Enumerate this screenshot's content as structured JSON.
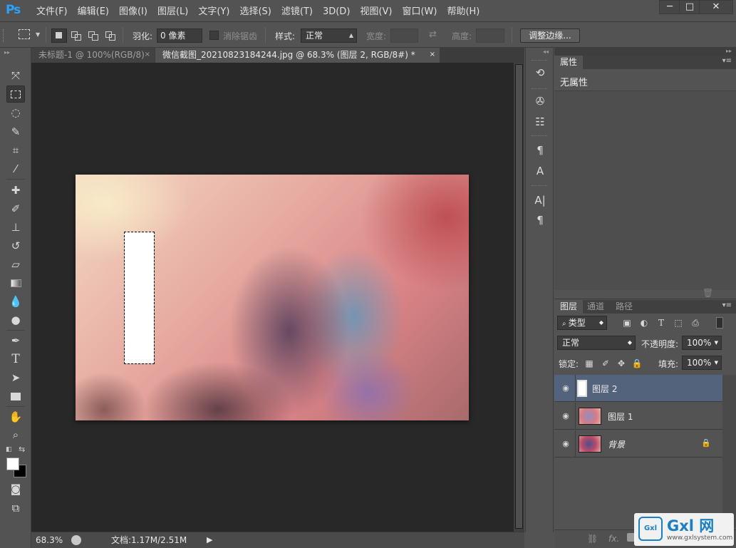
{
  "app": {
    "logo": "Ps"
  },
  "menu": [
    "文件(F)",
    "编辑(E)",
    "图像(I)",
    "图层(L)",
    "文字(Y)",
    "选择(S)",
    "滤镜(T)",
    "3D(D)",
    "视图(V)",
    "窗口(W)",
    "帮助(H)"
  ],
  "window_controls": {
    "minimize": "─",
    "maximize": "□",
    "close": "✕"
  },
  "options": {
    "feather_label": "羽化:",
    "feather_value": "0 像素",
    "antialias_label": "消除锯齿",
    "style_label": "样式:",
    "style_value": "正常",
    "width_label": "宽度:",
    "height_label": "高度:",
    "refine_button": "调整边缘..."
  },
  "tabs": [
    {
      "label": "未标题-1 @ 100%(RGB/8)",
      "close": "×"
    },
    {
      "label": "微信截图_20210823184244.jpg @ 68.3% (图层 2, RGB/8#) *",
      "close": "×"
    }
  ],
  "status": {
    "zoom": "68.3%",
    "doc_info": "文档:1.17M/2.51M",
    "arrow": "▶"
  },
  "properties": {
    "tab": "属性",
    "text": "无属性"
  },
  "layers": {
    "tabs": [
      "图层",
      "通道",
      "路径"
    ],
    "filter_label": "类型",
    "blend_mode": "正常",
    "opacity_label": "不透明度:",
    "opacity_value": "100%",
    "lock_label": "锁定:",
    "fill_label": "填充:",
    "fill_value": "100%",
    "items": [
      {
        "name": "图层 2",
        "selected": true
      },
      {
        "name": "图层 1",
        "selected": false
      },
      {
        "name": "背景",
        "selected": false,
        "locked": true
      }
    ],
    "footer": [
      "⛓",
      "fx."
    ]
  },
  "watermark": {
    "title": "Gxl 网",
    "url": "www.gxlsystem.com",
    "mark": "Gxl"
  },
  "colors": {
    "accent": "#2aa2ff",
    "selected_layer": "#52637b",
    "panel_bg": "#535353",
    "canvas_bg": "#282828"
  }
}
